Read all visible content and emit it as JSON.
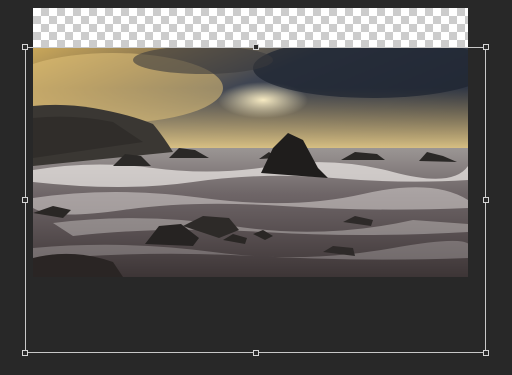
{
  "document": {
    "image_subject": "seascape",
    "colors": {
      "workspace": "#282828",
      "transform_border": "#c8c8c8",
      "checker_light": "#ffffff",
      "checker_dark": "#cccccc"
    }
  },
  "transform": {
    "handles": [
      "top-left",
      "top-center",
      "top-right",
      "middle-left",
      "middle-right",
      "bottom-left",
      "bottom-center",
      "bottom-right"
    ]
  }
}
